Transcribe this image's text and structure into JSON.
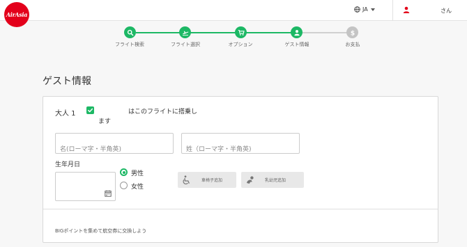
{
  "header": {
    "logo_text": "AirAsia",
    "language": "JA",
    "user_name": "さん"
  },
  "colors": {
    "brand_red": "#e3001b",
    "accent_green": "#1db865",
    "inactive_gray": "#c4c4c4"
  },
  "stepper": {
    "steps": [
      {
        "label": "フライト検索",
        "icon": "search-icon",
        "state": "done"
      },
      {
        "label": "フライト選択",
        "icon": "airplane-icon",
        "state": "done"
      },
      {
        "label": "オプション",
        "icon": "cart-icon",
        "state": "done"
      },
      {
        "label": "ゲスト情報",
        "icon": "person-icon",
        "state": "current"
      },
      {
        "label": "お支払",
        "icon": "dollar-icon",
        "state": "upcoming"
      }
    ]
  },
  "page": {
    "title": "ゲスト情報"
  },
  "guest": {
    "label": "大人 1",
    "infant_checkbox_checked": true,
    "infant_text_line1": "はこのフライトに搭乗し",
    "infant_text_line2": "ます",
    "first_name_placeholder": "名(ローマ字・半角英)",
    "last_name_placeholder": "姓（ローマ字・半角英)",
    "dob_label": "生年月日",
    "gender_options": [
      {
        "label": "男性",
        "checked": true
      },
      {
        "label": "女性",
        "checked": false
      }
    ],
    "wheelchair_label": "車椅子追加",
    "infant_add_label": "乳幼児追加",
    "big_points_text": "BIGポイントを集めて航空券に交換しよう"
  }
}
